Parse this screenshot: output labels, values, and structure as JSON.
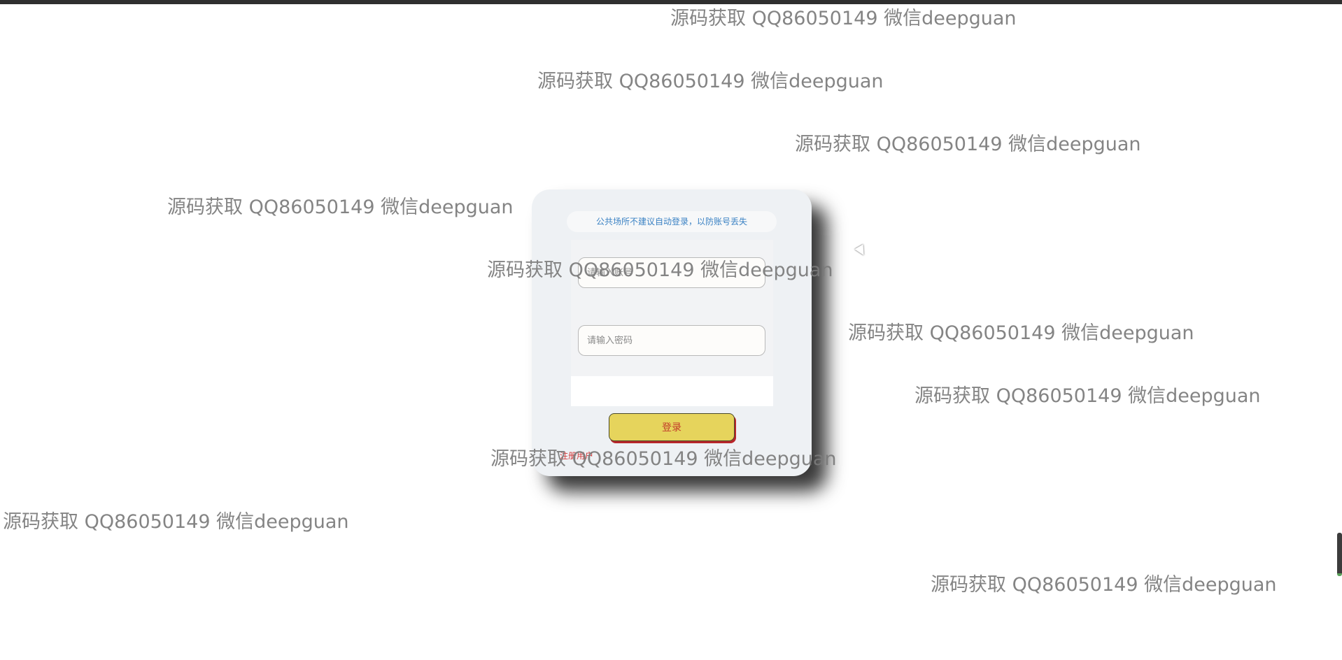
{
  "notice": {
    "text": "公共场所不建议自动登录，以防账号丢失"
  },
  "form": {
    "account_placeholder": "请输入账号",
    "password_placeholder": "请输入密码",
    "login_label": "登录",
    "register_label": "注册用户"
  },
  "watermark": {
    "text": "源码获取 QQ86050149 微信deepguan"
  },
  "colors": {
    "card_background": "#eef1f4",
    "button_background": "#e6d45c",
    "button_text": "#c23a2a",
    "notice_text": "#3b82c4"
  }
}
